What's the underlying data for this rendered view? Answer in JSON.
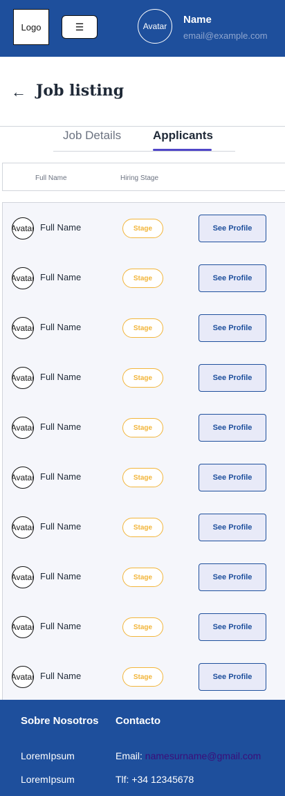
{
  "header": {
    "logo": "Logo",
    "menu_icon": "hamburger-icon",
    "menu_glyph": "☰",
    "avatar": "Avatar",
    "name": "Name",
    "email": "email@example.com"
  },
  "page": {
    "back_icon": "arrow-left-icon",
    "back_glyph": "←",
    "title": "Job listing"
  },
  "tabs": [
    {
      "label": "Job Details",
      "active": false
    },
    {
      "label": "Applicants",
      "active": true
    }
  ],
  "table": {
    "columns": [
      "Full Name",
      "Hiring Stage"
    ],
    "rows": [
      {
        "avatar": "Avatar",
        "name": "Full Name",
        "stage": "Stage",
        "action": "See Profile"
      },
      {
        "avatar": "Avatar",
        "name": "Full Name",
        "stage": "Stage",
        "action": "See Profile"
      },
      {
        "avatar": "Avatar",
        "name": "Full Name",
        "stage": "Stage",
        "action": "See Profile"
      },
      {
        "avatar": "Avatar",
        "name": "Full Name",
        "stage": "Stage",
        "action": "See Profile"
      },
      {
        "avatar": "Avatar",
        "name": "Full Name",
        "stage": "Stage",
        "action": "See Profile"
      },
      {
        "avatar": "Avatar",
        "name": "Full Name",
        "stage": "Stage",
        "action": "See Profile"
      },
      {
        "avatar": "Avatar",
        "name": "Full Name",
        "stage": "Stage",
        "action": "See Profile"
      },
      {
        "avatar": "Avatar",
        "name": "Full Name",
        "stage": "Stage",
        "action": "See Profile"
      },
      {
        "avatar": "Avatar",
        "name": "Full Name",
        "stage": "Stage",
        "action": "See Profile"
      },
      {
        "avatar": "Avatar",
        "name": "Full Name",
        "stage": "Stage",
        "action": "See Profile"
      }
    ]
  },
  "footer": {
    "about_heading": "Sobre Nosotros",
    "contact_heading": "Contacto",
    "about_links": [
      "LoremIpsum",
      "LoremIpsum"
    ],
    "email_label": "Email: ",
    "email_value": "namesurname@gmail.com",
    "phone": "Tlf: +34 12345678"
  },
  "colors": {
    "brand": "#1e4f9c",
    "tab_accent": "#5046c8",
    "stage": "#f2b53a",
    "button_bg": "#e8eaf8"
  }
}
